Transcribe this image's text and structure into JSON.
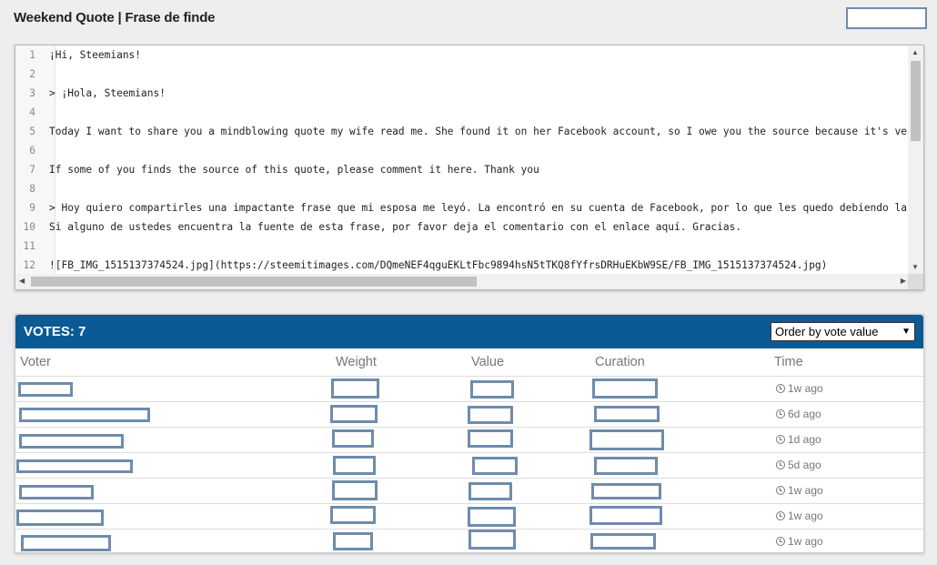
{
  "page": {
    "title": "Weekend Quote | Frase de finde"
  },
  "editor": {
    "lines": [
      {
        "num": "1",
        "text": "¡Hi, Steemians!"
      },
      {
        "num": "2",
        "text": ""
      },
      {
        "num": "3",
        "text": "> ¡Hola, Steemians!"
      },
      {
        "num": "4",
        "text": ""
      },
      {
        "num": "5",
        "text": "Today I want to share you a mindblowing quote my wife read me. She found it on her Facebook account, so I owe you the source because it's very"
      },
      {
        "num": "6",
        "text": ""
      },
      {
        "num": "7",
        "text": "If some of you finds the source of this quote, please comment it here. Thank you"
      },
      {
        "num": "8",
        "text": ""
      },
      {
        "num": "9",
        "text": "> Hoy quiero compartirles una impactante frase que mi esposa me leyó. La encontró en su cuenta de Facebook, por lo que les quedo debiendo la fu"
      },
      {
        "num": "10",
        "text": "Si alguno de ustedes encuentra la fuente de esta frase, por favor deja el comentario con el enlace aquí. Gracias."
      },
      {
        "num": "11",
        "text": ""
      },
      {
        "num": "12",
        "text": "![FB_IMG_1515137374524.jpg](https://steemitimages.com/DQmeNEF4qguEKLtFbc9894hsN5tTKQ8fYfrsDRHuEKbW9SE/FB_IMG_1515137374524.jpg)"
      }
    ]
  },
  "votes": {
    "title": "VOTES: 7",
    "order_label": "Order by vote value",
    "columns": {
      "voter": "Voter",
      "weight": "Weight",
      "value": "Value",
      "curation": "Curation",
      "time": "Time"
    },
    "rows": [
      {
        "time": "1w ago"
      },
      {
        "time": "6d ago"
      },
      {
        "time": "1d ago"
      },
      {
        "time": "5d ago"
      },
      {
        "time": "1w ago"
      },
      {
        "time": "1w ago"
      },
      {
        "time": "1w ago"
      }
    ]
  },
  "colors": {
    "header_bg": "#0b5a95",
    "redaction_border": "#6e8cad"
  }
}
